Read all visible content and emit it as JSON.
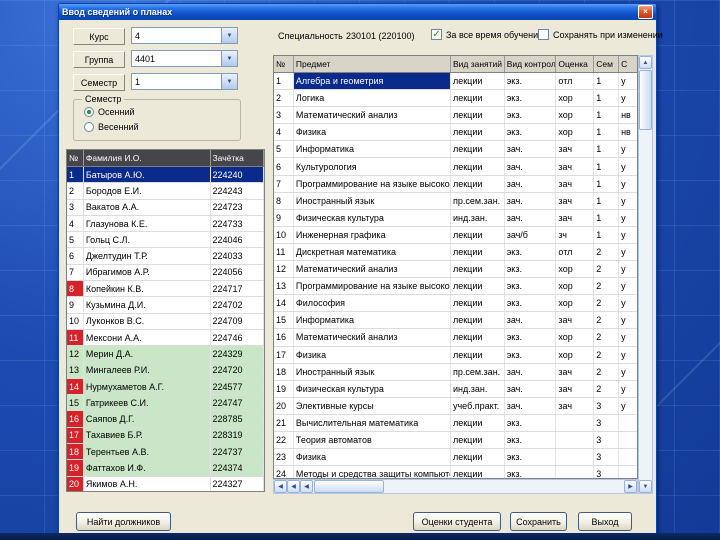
{
  "window": {
    "title": "Ввод сведений о планах",
    "close_label": "×"
  },
  "filters": {
    "course_label": "Курс",
    "course_value": "4",
    "group_label": "Группа",
    "group_value": "4401",
    "semester_label": "Семестр",
    "semester_value": "1",
    "semester_group": {
      "title": "Семестр",
      "options": [
        {
          "label": "Осенний",
          "selected": true
        },
        {
          "label": "Весенний",
          "selected": false
        }
      ]
    }
  },
  "students": {
    "columns": [
      "№",
      "Фамилия И.О.",
      "Зачётка"
    ],
    "rows": [
      {
        "n": 1,
        "name": "Батыров А.Ю.",
        "book": "224240",
        "sel": true,
        "red": false,
        "green": false
      },
      {
        "n": 2,
        "name": "Бородов Е.И.",
        "book": "224243",
        "sel": false,
        "red": false,
        "green": false
      },
      {
        "n": 3,
        "name": "Вакатов А.А.",
        "book": "224723",
        "sel": false,
        "red": false,
        "green": false
      },
      {
        "n": 4,
        "name": "Глазунова К.Е.",
        "book": "224733",
        "sel": false,
        "red": false,
        "green": false
      },
      {
        "n": 5,
        "name": "Гольц С.Л.",
        "book": "224046",
        "sel": false,
        "red": false,
        "green": false
      },
      {
        "n": 6,
        "name": "Джелтудин Т.Р.",
        "book": "224033",
        "sel": false,
        "red": false,
        "green": false
      },
      {
        "n": 7,
        "name": "Ибрагимов А.Р.",
        "book": "224056",
        "sel": false,
        "red": false,
        "green": false
      },
      {
        "n": 8,
        "name": "Копейкин К.В.",
        "book": "224717",
        "sel": false,
        "red": true,
        "green": false
      },
      {
        "n": 9,
        "name": "Кузьмина Д.И.",
        "book": "224702",
        "sel": false,
        "red": false,
        "green": false
      },
      {
        "n": 10,
        "name": "Луконков В.С.",
        "book": "224709",
        "sel": false,
        "red": false,
        "green": false
      },
      {
        "n": 11,
        "name": "Мексони А.А.",
        "book": "224746",
        "sel": false,
        "red": true,
        "green": false
      },
      {
        "n": 12,
        "name": "Мерин Д.А.",
        "book": "224329",
        "sel": false,
        "red": false,
        "green": true
      },
      {
        "n": 13,
        "name": "Мингалеев Р.И.",
        "book": "224720",
        "sel": false,
        "red": false,
        "green": true
      },
      {
        "n": 14,
        "name": "Нурмухаметов А.Г.",
        "book": "224577",
        "sel": false,
        "red": true,
        "green": true
      },
      {
        "n": 15,
        "name": "Гатрикеев С.И.",
        "book": "224747",
        "sel": false,
        "red": false,
        "green": true
      },
      {
        "n": 16,
        "name": "Саяпов Д.Г.",
        "book": "228785",
        "sel": false,
        "red": true,
        "green": true
      },
      {
        "n": 17,
        "name": "Тахавиев Б.Р.",
        "book": "228319",
        "sel": false,
        "red": true,
        "green": true
      },
      {
        "n": 18,
        "name": "Терентьев А.В.",
        "book": "224737",
        "sel": false,
        "red": true,
        "green": true
      },
      {
        "n": 19,
        "name": "Фаттахов И.Ф.",
        "book": "224374",
        "sel": false,
        "red": true,
        "green": true
      },
      {
        "n": 20,
        "name": "Якимов А.Н.",
        "book": "224327",
        "sel": false,
        "red": true,
        "green": false
      }
    ]
  },
  "specialty": {
    "label": "Специальность",
    "value": "230101 (220100)",
    "checkbox_all_time": {
      "label": "За все время обучения",
      "checked": true
    },
    "checkbox_save": {
      "label": "Сохранять при изменении",
      "checked": false
    }
  },
  "subjects": {
    "columns": [
      "№",
      "Предмет",
      "Вид занятий",
      "Вид контроля",
      "Оценка",
      "Сем",
      "С"
    ],
    "rows": [
      {
        "n": 1,
        "subject": "Алгебра и геометрия",
        "type": "лекции",
        "control": "экз.",
        "grade": "отл",
        "sem": "1",
        "st": "у",
        "selected": true
      },
      {
        "n": 2,
        "subject": "Логика",
        "type": "лекции",
        "control": "экз.",
        "grade": "хор",
        "sem": "1",
        "st": "у",
        "selected": false
      },
      {
        "n": 3,
        "subject": "Математический анализ",
        "type": "лекции",
        "control": "экз.",
        "grade": "хор",
        "sem": "1",
        "st": "нв",
        "selected": false
      },
      {
        "n": 4,
        "subject": "Физика",
        "type": "лекции",
        "control": "экз.",
        "grade": "хор",
        "sem": "1",
        "st": "нв",
        "selected": false
      },
      {
        "n": 5,
        "subject": "Информатика",
        "type": "лекции",
        "control": "зач.",
        "grade": "зач",
        "sem": "1",
        "st": "у",
        "selected": false
      },
      {
        "n": 6,
        "subject": "Культурология",
        "type": "лекции",
        "control": "зач.",
        "grade": "зач",
        "sem": "1",
        "st": "у",
        "selected": false
      },
      {
        "n": 7,
        "subject": "Программирование на языке высокого",
        "type": "лекции",
        "control": "зач.",
        "grade": "зач",
        "sem": "1",
        "st": "у",
        "selected": false
      },
      {
        "n": 8,
        "subject": "Иностранный язык",
        "type": "пр.сем.зан.",
        "control": "зач.",
        "grade": "зач",
        "sem": "1",
        "st": "у",
        "selected": false
      },
      {
        "n": 9,
        "subject": "Физическая культура",
        "type": "инд.зан.",
        "control": "зач.",
        "grade": "зач",
        "sem": "1",
        "st": "у",
        "selected": false
      },
      {
        "n": 10,
        "subject": "Инженерная графика",
        "type": "лекции",
        "control": "зач/б",
        "grade": "зч",
        "sem": "1",
        "st": "у",
        "selected": false
      },
      {
        "n": 11,
        "subject": "Дискретная математика",
        "type": "лекции",
        "control": "экз.",
        "grade": "отл",
        "sem": "2",
        "st": "у",
        "selected": false
      },
      {
        "n": 12,
        "subject": "Математический анализ",
        "type": "лекции",
        "control": "экз.",
        "grade": "хор",
        "sem": "2",
        "st": "у",
        "selected": false
      },
      {
        "n": 13,
        "subject": "Программирование на языке высокого",
        "type": "лекции",
        "control": "экз.",
        "grade": "хор",
        "sem": "2",
        "st": "у",
        "selected": false
      },
      {
        "n": 14,
        "subject": "Философия",
        "type": "лекции",
        "control": "экз.",
        "grade": "хор",
        "sem": "2",
        "st": "у",
        "selected": false
      },
      {
        "n": 15,
        "subject": "Информатика",
        "type": "лекции",
        "control": "зач.",
        "grade": "зач",
        "sem": "2",
        "st": "у",
        "selected": false
      },
      {
        "n": 16,
        "subject": "Математический анализ",
        "type": "лекции",
        "control": "экз.",
        "grade": "хор",
        "sem": "2",
        "st": "у",
        "selected": false
      },
      {
        "n": 17,
        "subject": "Физика",
        "type": "лекции",
        "control": "экз.",
        "grade": "хор",
        "sem": "2",
        "st": "у",
        "selected": false
      },
      {
        "n": 18,
        "subject": "Иностранный язык",
        "type": "пр.сем.зан.",
        "control": "зач.",
        "grade": "зач",
        "sem": "2",
        "st": "у",
        "selected": false
      },
      {
        "n": 19,
        "subject": "Физическая культура",
        "type": "инд.зан.",
        "control": "зач.",
        "grade": "зач",
        "sem": "2",
        "st": "у",
        "selected": false
      },
      {
        "n": 20,
        "subject": "Элективные курсы",
        "type": "учеб.практ.",
        "control": "зач.",
        "grade": "зач",
        "sem": "3",
        "st": "у",
        "selected": false
      },
      {
        "n": 21,
        "subject": "Вычислительная математика",
        "type": "лекции",
        "control": "экз.",
        "grade": "",
        "sem": "3",
        "st": "",
        "selected": false
      },
      {
        "n": 22,
        "subject": "Теория автоматов",
        "type": "лекции",
        "control": "экз.",
        "grade": "",
        "sem": "3",
        "st": "",
        "selected": false
      },
      {
        "n": 23,
        "subject": "Физика",
        "type": "лекции",
        "control": "экз.",
        "grade": "",
        "sem": "3",
        "st": "",
        "selected": false
      },
      {
        "n": 24,
        "subject": "Методы и средства защиты компьютерной",
        "type": "лекции",
        "control": "экз.",
        "grade": "",
        "sem": "3",
        "st": "",
        "selected": false
      }
    ]
  },
  "scrollbars": {
    "up_arrow": "▲",
    "down_arrow": "▼",
    "left_arrow": "◀",
    "right_arrow": "▶",
    "combo_arrow": "▼"
  },
  "buttons": {
    "find_debtors": "Найти должников",
    "student_grades": "Оценки студента",
    "save": "Сохранить",
    "exit": "Выход"
  }
}
